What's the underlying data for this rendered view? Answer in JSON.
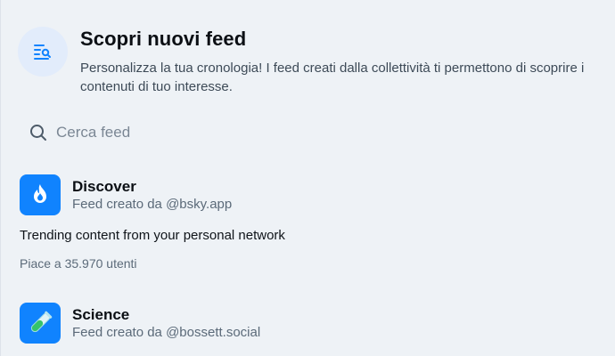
{
  "header": {
    "title": "Scopri nuovi feed",
    "description": "Personalizza la tua cronologia! I feed creati dalla collettività ti permettono di scoprire i contenuti di tuo interesse.",
    "icon": "list-search-icon"
  },
  "search": {
    "placeholder": "Cerca feed",
    "value": "",
    "icon": "search-icon"
  },
  "feeds": [
    {
      "name": "Discover",
      "creator": "Feed creato da @bsky.app",
      "description": "Trending content from your personal network",
      "likes": "Piace a 35.970 utenti",
      "icon": "flame-icon",
      "color": "#1083fe"
    },
    {
      "name": "Science",
      "creator": "Feed creato da @bossett.social",
      "icon": "test-tube-icon",
      "color": "#1083fe"
    }
  ],
  "colors": {
    "background": "#eef2f6",
    "accent": "#1083fe",
    "muted_text": "#5b6a79"
  }
}
